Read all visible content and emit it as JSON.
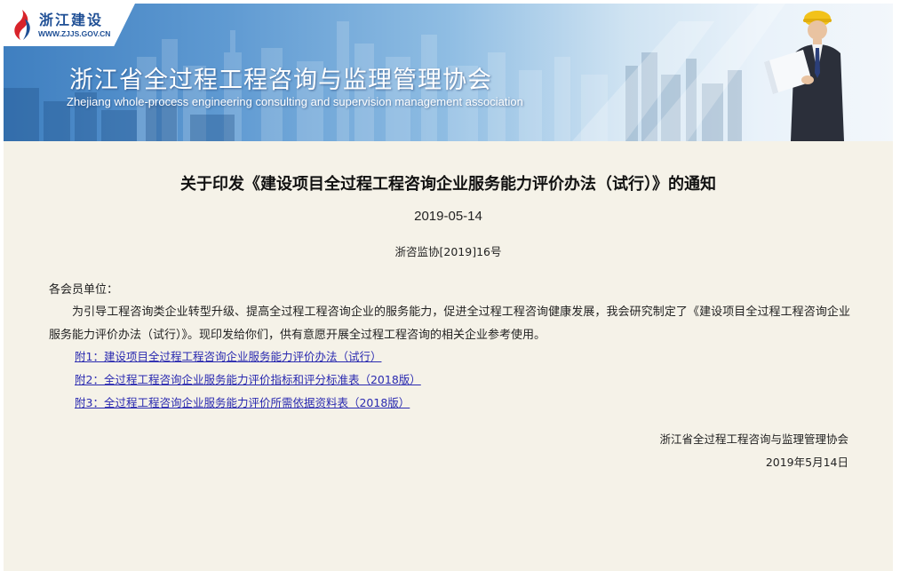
{
  "header": {
    "logo_name": "浙江建设",
    "logo_url": "WWW.ZJJS.GOV.CN",
    "site_title": "浙江省全过程工程咨询与监理管理协会",
    "site_subtitle": "Zhejiang whole-process engineering consulting and supervision management association"
  },
  "article": {
    "title": "关于印发《建设项目全过程工程咨询企业服务能力评价办法（试行）》的通知",
    "date": "2019-05-14",
    "doc_number": "浙咨监协[2019]16号",
    "salutation": "各会员单位：",
    "body": "为引导工程咨询类企业转型升级、提高全过程工程咨询企业的服务能力，促进全过程工程咨询健康发展，我会研究制定了《建设项目全过程工程咨询企业服务能力评价办法（试行）》。现印发给你们，供有意愿开展全过程工程咨询的相关企业参考使用。",
    "attachments": [
      {
        "label": "附1：建设项目全过程工程咨询企业服务能力评价办法（试行）"
      },
      {
        "label": "附2：全过程工程咨询企业服务能力评价指标和评分标准表（2018版）"
      },
      {
        "label": "附3：全过程工程咨询企业服务能力评价所需依据资料表（2018版）"
      }
    ],
    "signature_org": "浙江省全过程工程咨询与监理管理协会",
    "signature_date": "2019年5月14日"
  },
  "colors": {
    "link": "#2a2ab0",
    "page_background": "#f5f2e8",
    "banner_blue": "#3f7fc0"
  }
}
